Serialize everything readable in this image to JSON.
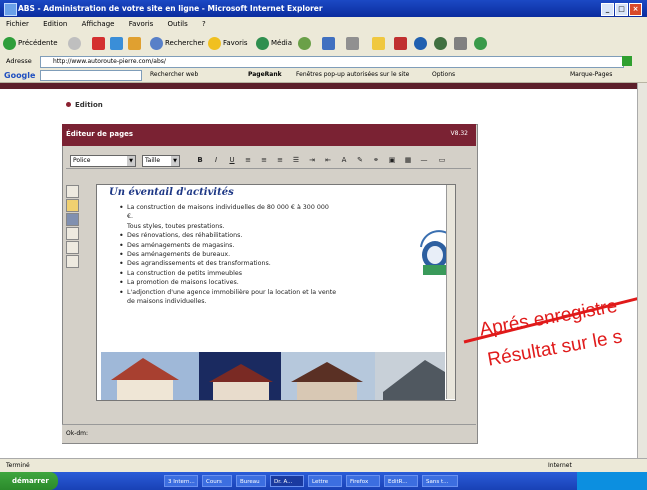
{
  "window": {
    "title": "ABS - Administration de votre site en ligne - Microsoft Internet Explorer"
  },
  "menu": [
    "Fichier",
    "Edition",
    "Affichage",
    "Favoris",
    "Outils",
    "?"
  ],
  "toolbar": {
    "back": "Précédente",
    "search": "Rechercher",
    "favorites": "Favoris",
    "media": "Média"
  },
  "address": {
    "label": "Adresse",
    "url": "http://www.autoroute-pierre.com/abs/"
  },
  "googlebar": {
    "logo": "Google",
    "search_web": "Rechercher web",
    "pagerank": "PageRank",
    "popups": "Fenêtres pop-up autorisées sur le site",
    "options": "Options",
    "bookmarks": "Marque-Pages"
  },
  "page": {
    "edition_label": "Edition",
    "editor_title": "Éditeur de pages",
    "editor_version": "V8.32",
    "format_select": "Police",
    "size_select": "Taille",
    "doc_title": "Un éventail d'activités",
    "items": [
      {
        "text": "La construction de maisons individuelles de 80 000 € à 300 000",
        "bullet": true
      },
      {
        "text": "€.",
        "bullet": false
      },
      {
        "text": "Tous styles, toutes prestations.",
        "bullet": false
      },
      {
        "text": "Des rénovations, des réhabilitations.",
        "bullet": true
      },
      {
        "text": "Des aménagements de magasins.",
        "bullet": true
      },
      {
        "text": "Des aménagements de bureaux.",
        "bullet": true
      },
      {
        "text": "Des agrandissements et des transformations.",
        "bullet": true
      },
      {
        "text": "La construction de petits immeubles",
        "bullet": true
      },
      {
        "text": "La promotion de maisons locatives.",
        "bullet": true
      },
      {
        "text": "L'adjonction d'une agence immobilière pour la location et la vente",
        "bullet": true
      },
      {
        "text": "de maisons individuelles.",
        "bullet": false
      }
    ],
    "status": "Ok-dm:"
  },
  "annotation": {
    "line1": "Aprés enregistre",
    "line2": "Résultat sur le s"
  },
  "iestatus": {
    "left": "Terminé",
    "right": "Internet"
  },
  "taskbar": {
    "start": "démarrer",
    "tasks": [
      "3 Intern...",
      "Cours",
      "Bureau",
      "Dr. A...",
      "Lettre",
      "Firefox",
      "EditR...",
      "Sans t..."
    ]
  },
  "colors": {
    "header": "#7a2233",
    "annotation": "#e01a1a",
    "title": "#1d3785"
  }
}
